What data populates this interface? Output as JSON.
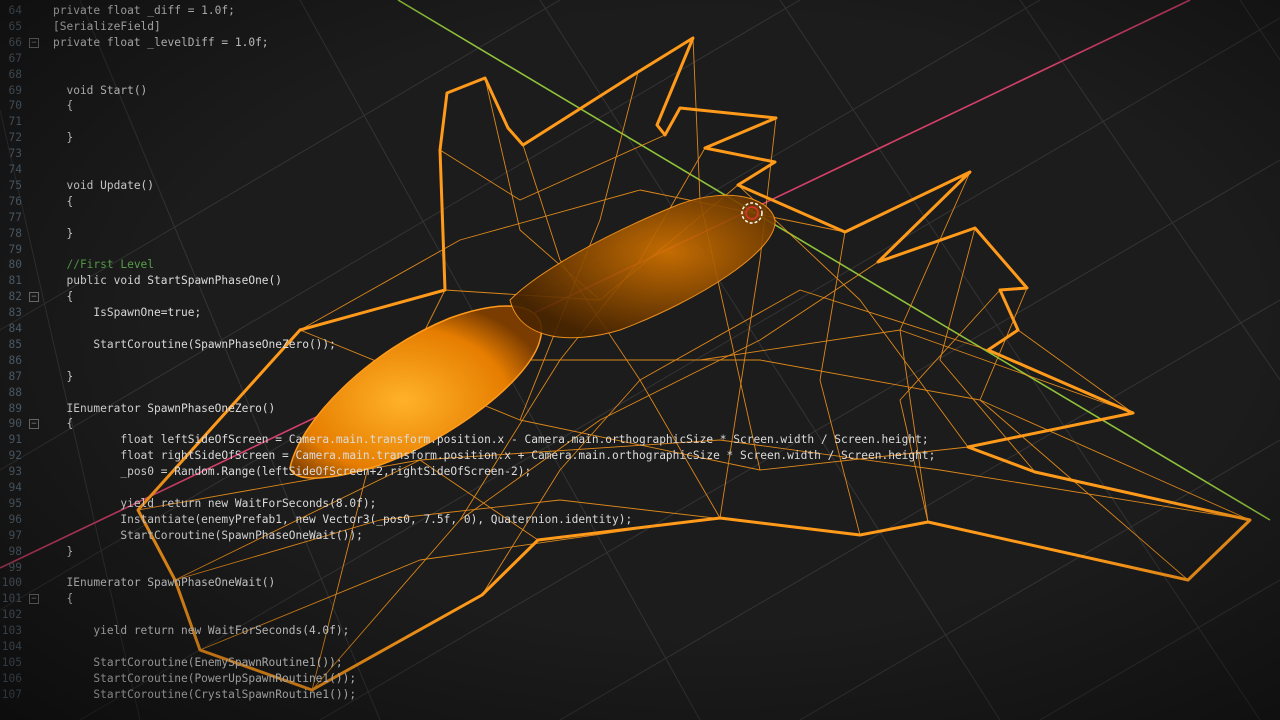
{
  "editor": {
    "lines": [
      {
        "num": "64",
        "text": "private float _diff = 1.0f;"
      },
      {
        "num": "65",
        "text": "[SerializeField]"
      },
      {
        "num": "66",
        "text": "private float _levelDiff = 1.0f;",
        "fold": true
      },
      {
        "num": "67",
        "text": ""
      },
      {
        "num": "68",
        "text": ""
      },
      {
        "num": "69",
        "text": "  void Start()"
      },
      {
        "num": "70",
        "text": "  {"
      },
      {
        "num": "71",
        "text": ""
      },
      {
        "num": "72",
        "text": "  }"
      },
      {
        "num": "73",
        "text": ""
      },
      {
        "num": "74",
        "text": ""
      },
      {
        "num": "75",
        "text": "  void Update()"
      },
      {
        "num": "76",
        "text": "  {"
      },
      {
        "num": "77",
        "text": ""
      },
      {
        "num": "78",
        "text": "  }"
      },
      {
        "num": "79",
        "text": ""
      },
      {
        "num": "80",
        "text": "  //First Level"
      },
      {
        "num": "81",
        "text": "  public void StartSpawnPhaseOne()"
      },
      {
        "num": "82",
        "text": "  {",
        "fold": true
      },
      {
        "num": "83",
        "text": "      IsSpawnOne=true;"
      },
      {
        "num": "84",
        "text": ""
      },
      {
        "num": "85",
        "text": "      StartCoroutine(SpawnPhaseOneZero());"
      },
      {
        "num": "86",
        "text": ""
      },
      {
        "num": "87",
        "text": "  }"
      },
      {
        "num": "88",
        "text": ""
      },
      {
        "num": "89",
        "text": "  IEnumerator SpawnPhaseOneZero()"
      },
      {
        "num": "90",
        "text": "  {",
        "fold": true
      },
      {
        "num": "91",
        "text": "          float leftSideOfScreen = Camera.main.transform.position.x - Camera.main.orthographicSize * Screen.width / Screen.height;"
      },
      {
        "num": "92",
        "text": "          float rightSideOfScreen = Camera.main.transform.position.x + Camera.main.orthographicSize * Screen.width / Screen.height;"
      },
      {
        "num": "93",
        "text": "          _pos0 = Random.Range(leftSideOfScreen+2,rightSideOfScreen-2);"
      },
      {
        "num": "94",
        "text": ""
      },
      {
        "num": "95",
        "text": "          yield return new WaitForSeconds(8.0f);"
      },
      {
        "num": "96",
        "text": "          Instantiate(enemyPrefab1, new Vector3(_pos0, 7.5f, 0), Quaternion.identity);"
      },
      {
        "num": "97",
        "text": "          StartCoroutine(SpawnPhaseOneWait());"
      },
      {
        "num": "98",
        "text": "  }"
      },
      {
        "num": "99",
        "text": ""
      },
      {
        "num": "100",
        "text": "  IEnumerator SpawnPhaseOneWait()"
      },
      {
        "num": "101",
        "text": "  {",
        "fold": true
      },
      {
        "num": "102",
        "text": ""
      },
      {
        "num": "103",
        "text": "      yield return new WaitForSeconds(4.0f);"
      },
      {
        "num": "104",
        "text": ""
      },
      {
        "num": "105",
        "text": "      StartCoroutine(EnemySpawnRoutine1());"
      },
      {
        "num": "106",
        "text": "      StartCoroutine(PowerUpSpawnRoutine1());"
      },
      {
        "num": "107",
        "text": "      StartCoroutine(CrystalSpawnRoutine1());"
      }
    ]
  },
  "colors": {
    "background": "#1c1c1c",
    "grid": "#3a3a3a",
    "wireframe": "#ff9a1a",
    "axis_red": "#d6406a",
    "axis_green": "#8fc23a"
  }
}
